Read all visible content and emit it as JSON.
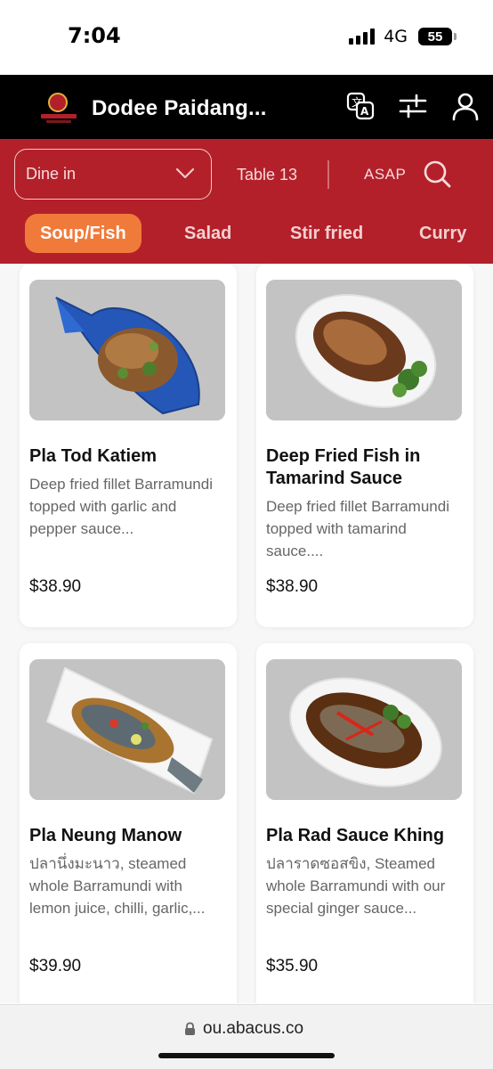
{
  "status_bar": {
    "time": "7:04",
    "network": "4G",
    "battery": "55"
  },
  "header": {
    "restaurant_name": "Dodee Paidang...",
    "logo": "dodee-paidang-logo",
    "icons": [
      "translate-icon",
      "filter-sliders-icon",
      "user-icon"
    ]
  },
  "order_bar": {
    "mode_value": "Dine in",
    "table": "Table 13",
    "time": "ASAP"
  },
  "categories": [
    {
      "label": "Soup/Fish",
      "active": true
    },
    {
      "label": "Salad",
      "active": false
    },
    {
      "label": "Stir fried",
      "active": false
    },
    {
      "label": "Curry",
      "active": false
    }
  ],
  "menu_items": [
    {
      "title": "Pla Tod Katiem",
      "description": "Deep fried fillet Barramundi topped with garlic and pepper sauce...",
      "price": "$38.90"
    },
    {
      "title": "Deep Fried Fish in Tamarind Sauce",
      "description": "Deep fried fillet Barramundi topped with tamarind sauce....",
      "price": "$38.90"
    },
    {
      "title": "Pla Neung Manow",
      "description": "ปลานึ่งมะนาว, steamed whole Barramundi with lemon juice, chilli, garlic,...",
      "price": "$39.90"
    },
    {
      "title": "Pla Rad Sauce Khing",
      "description": "ปลาราดซอสขิง, Steamed whole Barramundi with our special ginger sauce...",
      "price": "$35.90"
    }
  ],
  "browser": {
    "url": "ou.abacus.co"
  },
  "colors": {
    "brand_red": "#b3202a",
    "active_tab": "#f07a3a",
    "header_black": "#000000"
  }
}
